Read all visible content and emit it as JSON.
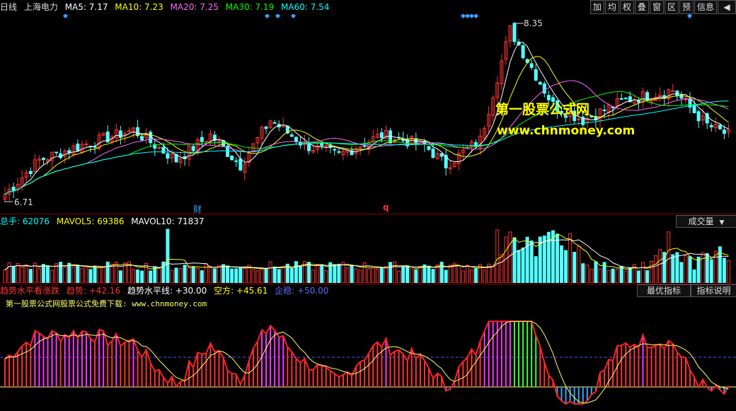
{
  "header": {
    "period": "日线",
    "stock": "上海电力",
    "ma": [
      {
        "label": "MA5: 7.17",
        "color": "#ffffff"
      },
      {
        "label": "MA10: 7.23",
        "color": "#ffff00"
      },
      {
        "label": "MA20: 7.25",
        "color": "#ff66ff"
      },
      {
        "label": "MA30: 7.19",
        "color": "#00ff00"
      },
      {
        "label": "MA60: 7.54",
        "color": "#00ffff"
      }
    ]
  },
  "toolbar": [
    "加",
    "均",
    "权",
    "叠",
    "窗",
    "区",
    "预",
    "信息"
  ],
  "price": {
    "high_label": "8.35",
    "low_label": "6.71",
    "marker_cai": "财",
    "marker_q": "q"
  },
  "watermark": {
    "line1": "第一股票公式网",
    "line2": "www.chnmoney.com"
  },
  "volume": {
    "items": [
      {
        "label": "总手: 62076",
        "color": "#00ffff"
      },
      {
        "label": "MAVOL5: 69386",
        "color": "#ffff00"
      },
      {
        "label": "MAVOL10: 71837",
        "color": "#ffffff"
      }
    ],
    "selector": "成交量"
  },
  "indicator": {
    "items": [
      {
        "label": "趋势水平看涨跌",
        "color": "#ff3333"
      },
      {
        "label": "趋势: +42.16",
        "color": "#ff3333"
      },
      {
        "label": "趋势水平线: +30.00",
        "color": "#ffffff"
      },
      {
        "label": "空方: +45.61",
        "color": "#ffff00"
      },
      {
        "label": "企稳: +50.00",
        "color": "#5555ff"
      }
    ],
    "note": "第一股票公式网股票公式免费下载: www.chnmoney.com",
    "best_button": "最优指标",
    "help_button": "指标说明"
  }
}
